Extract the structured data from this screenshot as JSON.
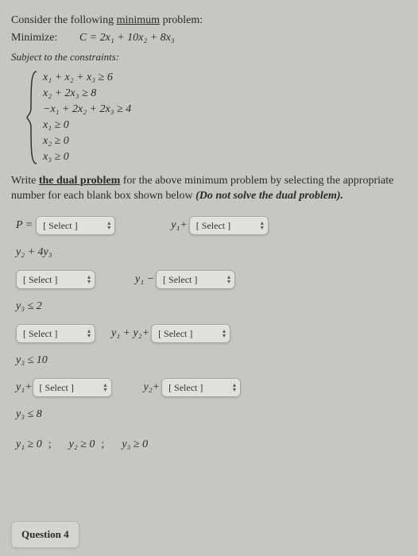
{
  "intro": {
    "prefix": "Consider the following ",
    "mintxt": "minimum",
    "suffix": " problem:"
  },
  "minimize": {
    "label": "Minimize:",
    "formula": "C = 2x₁ + 10x₂ + 8x₃"
  },
  "subject": "Subject to the constraints:",
  "constraints": [
    "x₁ + x₂ + x₃ ≥ 6",
    "x₂ + 2x₃ ≥ 8",
    "−x₁ + 2x₂ + 2x₃ ≥ 4",
    "x₁ ≥ 0",
    "x₂ ≥ 0",
    "x₃ ≥ 0"
  ],
  "write": {
    "p1": "Write ",
    "dual": "the dual problem",
    "p2": " for the above minimum problem by selecting the appropriate number for each blank box shown below ",
    "p3": "(Do not solve the dual problem).",
    "italic": ""
  },
  "select_placeholder": "[ Select ]",
  "rows": {
    "r1": {
      "lhs": "P = ",
      "mid": "y₁+",
      "tail": "y₂ + 4y₃"
    },
    "r2": {
      "mid": "y₁ −",
      "tail": "y₃ ≤ 2"
    },
    "r3": {
      "mid": "y₁ + y₂+",
      "tail": "y₃ ≤ 10"
    },
    "r4": {
      "lhs": "y₁+",
      "mid": "y₂+",
      "tail": "y₃ ≤ 8"
    }
  },
  "final": {
    "a": "y₁ ≥ 0",
    "b": "y₂ ≥ 0",
    "c": "y₃ ≥ 0",
    "sep": ";"
  },
  "question": "Question 4"
}
